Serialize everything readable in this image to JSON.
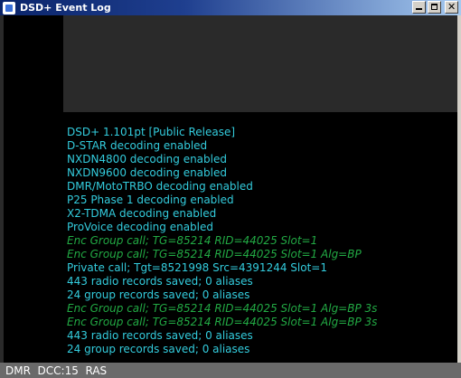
{
  "window": {
    "title": "DSD+ Event Log",
    "icon": "app-icon",
    "controls": [
      "minimize",
      "maximize",
      "close"
    ],
    "close_glyph": "✕"
  },
  "log": {
    "lines": [
      {
        "text": "DSD+ 1.101pt  [Public Release]",
        "kind": "info"
      },
      {
        "text": "D-STAR decoding enabled",
        "kind": "info"
      },
      {
        "text": "NXDN4800 decoding enabled",
        "kind": "info"
      },
      {
        "text": "NXDN9600 decoding enabled",
        "kind": "info"
      },
      {
        "text": "DMR/MotoTRBO decoding enabled",
        "kind": "info"
      },
      {
        "text": "P25 Phase 1 decoding enabled",
        "kind": "info"
      },
      {
        "text": "X2-TDMA decoding enabled",
        "kind": "info"
      },
      {
        "text": "ProVoice decoding enabled",
        "kind": "info"
      },
      {
        "text": "Enc Group call; TG=85214  RID=44025   Slot=1",
        "kind": "enc"
      },
      {
        "text": "Enc Group call; TG=85214  RID=44025   Slot=1  Alg=BP",
        "kind": "enc"
      },
      {
        "text": "Private call; Tgt=8521998  Src=4391244   Slot=1",
        "kind": "clear"
      },
      {
        "text": "443 radio records saved; 0 aliases",
        "kind": "info"
      },
      {
        "text": "24 group records saved; 0 aliases",
        "kind": "info"
      },
      {
        "text": "Enc Group call; TG=85214  RID=44025   Slot=1  Alg=BP  3s",
        "kind": "enc"
      },
      {
        "text": "Enc Group call; TG=85214  RID=44025   Slot=1  Alg=BP  3s",
        "kind": "enc"
      },
      {
        "text": "443 radio records saved; 0 aliases",
        "kind": "info"
      },
      {
        "text": "24 group records saved; 0 aliases",
        "kind": "info"
      }
    ]
  },
  "status": {
    "text": "DMR  DCC:15  RAS"
  },
  "colors": {
    "info": "#33ccdd",
    "encrypted": "#22aa44",
    "background": "#000000",
    "statusbar": "#6a6a6a"
  }
}
